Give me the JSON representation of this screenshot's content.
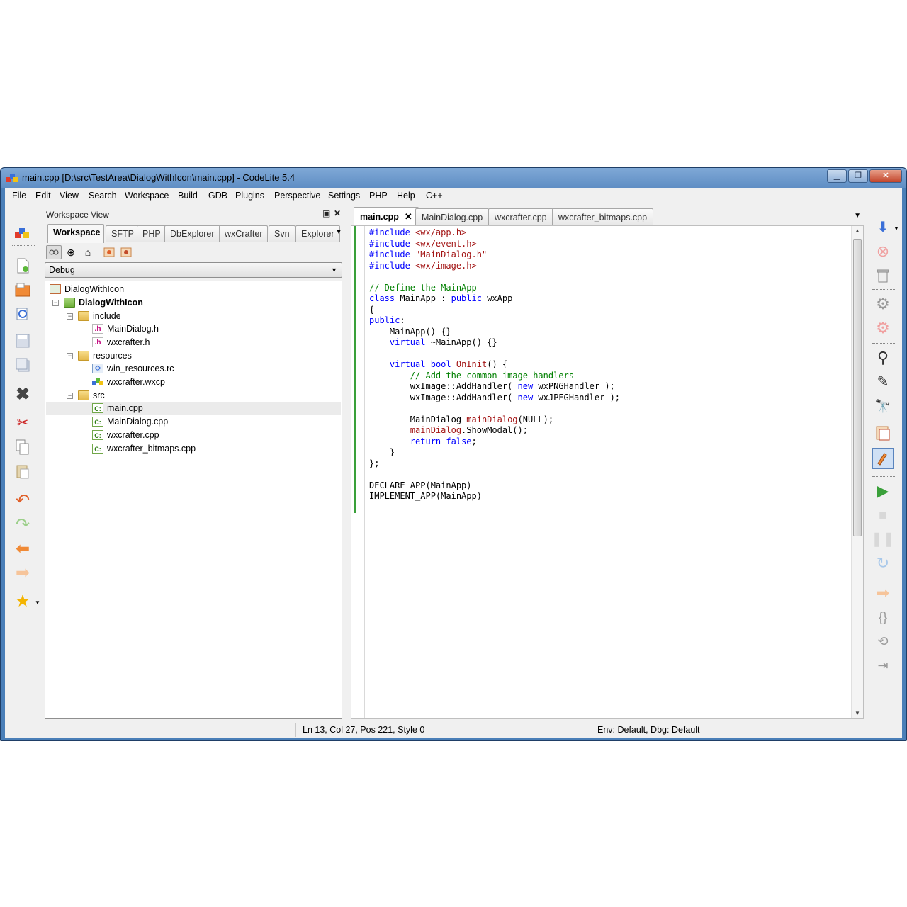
{
  "window": {
    "title": "main.cpp [D:\\src\\TestArea\\DialogWithIcon\\main.cpp] - CodeLite 5.4",
    "controls": {
      "minimize": "▁",
      "maximize": "❐",
      "close": "✕"
    }
  },
  "menu": [
    "File",
    "Edit",
    "View",
    "Search",
    "Workspace",
    "Build",
    "GDB",
    "Plugins",
    "Perspective",
    "Settings",
    "PHP",
    "Help",
    "C++"
  ],
  "workspace_view": {
    "caption": "Workspace View",
    "tabs": [
      "Workspace",
      "SFTP",
      "PHP",
      "DbExplorer",
      "wxCrafter",
      "Svn",
      "Explorer"
    ],
    "active_tab": "Workspace",
    "configuration": "Debug",
    "tree": {
      "workspace": "DialogWithIcon",
      "project": "DialogWithIcon",
      "folders": [
        {
          "name": "include",
          "files": [
            "MainDialog.h",
            "wxcrafter.h"
          ]
        },
        {
          "name": "resources",
          "files": [
            "win_resources.rc",
            "wxcrafter.wxcp"
          ]
        },
        {
          "name": "src",
          "files": [
            "main.cpp",
            "MainDialog.cpp",
            "wxcrafter.cpp",
            "wxcrafter_bitmaps.cpp"
          ]
        }
      ],
      "selected": "main.cpp"
    }
  },
  "editor": {
    "tabs": [
      "main.cpp",
      "MainDialog.cpp",
      "wxcrafter.cpp",
      "wxcrafter_bitmaps.cpp"
    ],
    "active_tab": "main.cpp",
    "close_glyph": "✕",
    "code_lines": [
      "#include <wx/app.h>",
      "#include <wx/event.h>",
      "#include \"MainDialog.h\"",
      "#include <wx/image.h>",
      "",
      "// Define the MainApp",
      "class MainApp : public wxApp",
      "{",
      "public:",
      "    MainApp() {}",
      "    virtual ~MainApp() {}",
      "",
      "    virtual bool OnInit() {",
      "        // Add the common image handlers",
      "        wxImage::AddHandler( new wxPNGHandler );",
      "        wxImage::AddHandler( new wxJPEGHandler );",
      "",
      "        MainDialog mainDialog(NULL);",
      "        mainDialog.ShowModal();",
      "        return false;",
      "    }",
      "};",
      "",
      "DECLARE_APP(MainApp)",
      "IMPLEMENT_APP(MainApp)"
    ]
  },
  "status": {
    "position": "Ln 13,  Col 27,  Pos 221, Style 0",
    "env": "Env: Default, Dbg: Default"
  },
  "colors": {
    "keyword": "#0000ff",
    "string": "#a31515",
    "comment": "#008000",
    "change_margin": "#3aa03a",
    "title_bar": "#5f8ec4"
  }
}
